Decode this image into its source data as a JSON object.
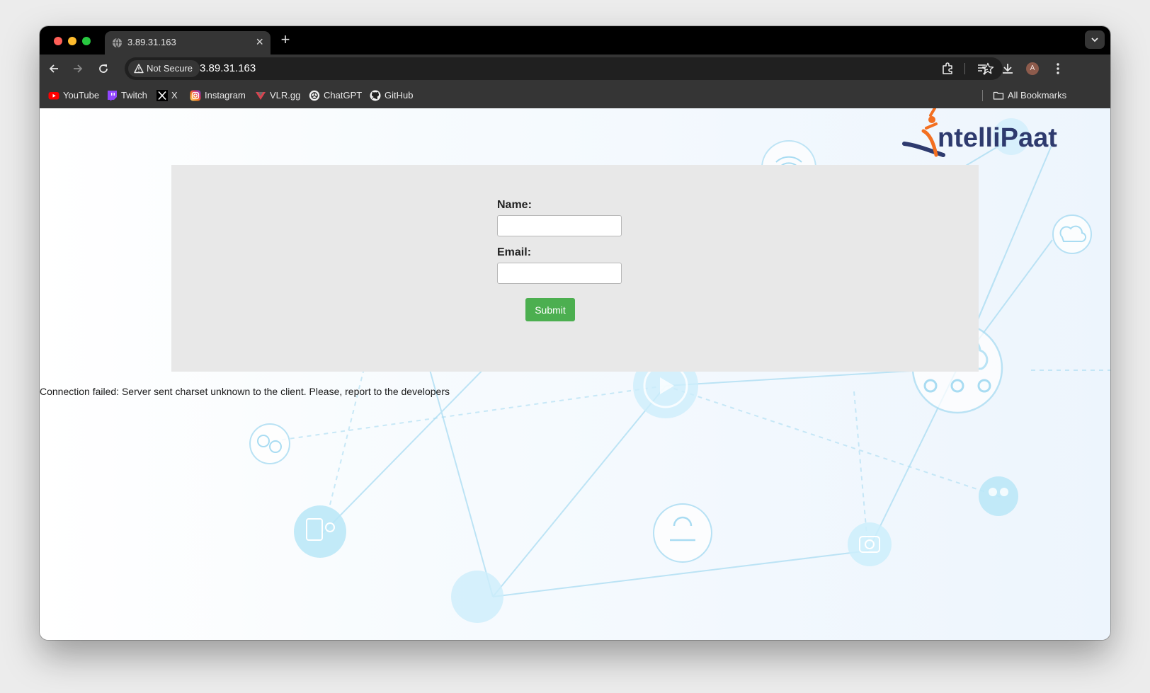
{
  "browser": {
    "tab": {
      "title": "3.89.31.163",
      "close_glyph": "×"
    },
    "new_tab_glyph": "+",
    "toolbar": {
      "security_chip": "Not Secure",
      "url": "3.89.31.163",
      "profile_initial": "A"
    },
    "bookmarks": [
      {
        "label": "YouTube",
        "icon": "youtube-icon",
        "color": "#ff0000"
      },
      {
        "label": "Twitch",
        "icon": "twitch-icon",
        "color": "#9146ff"
      },
      {
        "label": "X",
        "icon": "x-icon",
        "color": "#ffffff"
      },
      {
        "label": "Instagram",
        "icon": "instagram-icon",
        "color": "#e1306c"
      },
      {
        "label": "VLR.gg",
        "icon": "vlr-icon",
        "color": "#d9434f"
      },
      {
        "label": "ChatGPT",
        "icon": "chatgpt-icon",
        "color": "#ffffff"
      },
      {
        "label": "GitHub",
        "icon": "github-icon",
        "color": "#ffffff"
      }
    ],
    "all_bookmarks_label": "All Bookmarks"
  },
  "page": {
    "logo_text": "ntelliPaat",
    "logo_colors": {
      "orange": "#f36f21",
      "navy": "#2e3a6e"
    },
    "form": {
      "name_label": "Name:",
      "name_value": "",
      "email_label": "Email:",
      "email_value": "",
      "submit_label": "Submit"
    },
    "error_message": "Connection failed: Server sent charset unknown to the client. Please, report to the developers"
  },
  "colors": {
    "submit_green": "#4caf50",
    "form_panel": "#e8e8e8",
    "chrome_dark": "#353535"
  }
}
